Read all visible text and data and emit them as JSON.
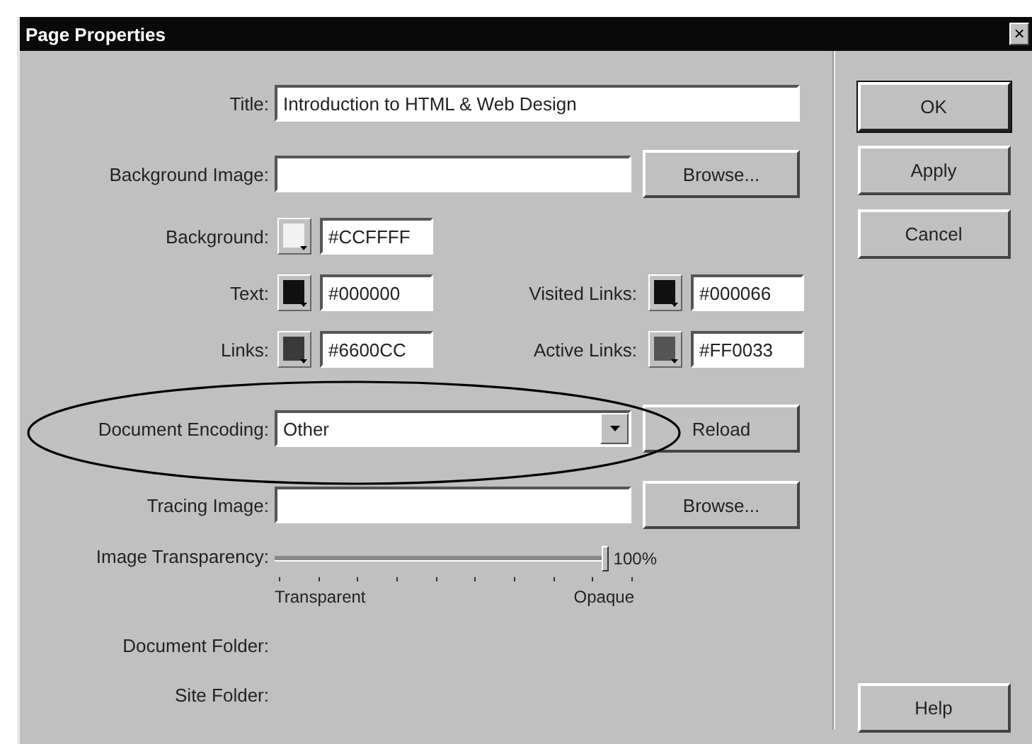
{
  "window": {
    "title": "Page Properties",
    "close": "×"
  },
  "fields": [
    {
      "kind": "text",
      "label": "Title:",
      "value": "Introduction to HTML & Web Design"
    },
    {
      "kind": "text",
      "label": "Background Image:",
      "button": "Browse..."
    },
    {
      "kind": "colors",
      "items": [
        {
          "label": "Background:",
          "color": "#f2f2f2",
          "value": "#CCFFFF"
        }
      ]
    },
    {
      "kind": "colors",
      "items": [
        {
          "label": "Text:",
          "color": "#111111",
          "value": "#000000"
        },
        {
          "label": "Visited Links:",
          "color": "#111111",
          "value": "#000066"
        }
      ]
    },
    {
      "kind": "colors",
      "items": [
        {
          "label": "Links:",
          "color": "#3a3a3a",
          "value": "#6600CC"
        },
        {
          "label": "Active Links:",
          "color": "#555555",
          "value": "#FF0033"
        }
      ]
    },
    {
      "kind": "select",
      "label": "Document Encoding:",
      "value": "Other",
      "button": "Reload"
    },
    {
      "kind": "text",
      "label": "Tracing Image:",
      "button": "Browse..."
    },
    {
      "kind": "slider",
      "label": "Image Transparency:",
      "level": 1,
      "reading": "100%",
      "min_label": "Transparent",
      "max_label": "Opaque"
    },
    {
      "kind": "info",
      "label": "Document Folder:"
    },
    {
      "kind": "info",
      "label": "Site Folder:"
    }
  ],
  "buttons": [
    {
      "label": "OK",
      "default": true
    },
    {
      "label": "Apply",
      "default": false
    },
    {
      "label": "Cancel",
      "default": false
    }
  ],
  "help": {
    "label": "Help"
  },
  "annotation": {
    "kind": "ellipse"
  }
}
